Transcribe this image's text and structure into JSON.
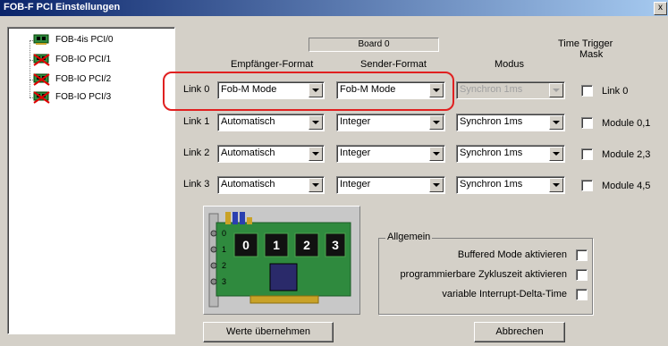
{
  "window": {
    "title": "FOB-F PCI Einstellungen",
    "close_label": "x"
  },
  "tree": [
    {
      "label": "FOB-4is PCI/0",
      "status": "ok"
    },
    {
      "label": "FOB-IO PCI/1",
      "status": "error"
    },
    {
      "label": "FOB-IO PCI/2",
      "status": "error"
    },
    {
      "label": "FOB-IO PCI/3",
      "status": "error"
    }
  ],
  "board_label": "Board 0",
  "headers": {
    "empfaenger": "Empfänger-Format",
    "sender": "Sender-Format",
    "modus": "Modus",
    "time_trigger": "Time Trigger",
    "mask": "Mask"
  },
  "links": [
    {
      "label": "Link 0",
      "empfaenger": "Fob-M Mode",
      "sender": "Fob-M Mode",
      "modus": "Synchron 1ms",
      "modus_disabled": true,
      "mask_label": "Link 0"
    },
    {
      "label": "Link 1",
      "empfaenger": "Automatisch",
      "sender": "Integer",
      "modus": "Synchron 1ms",
      "modus_disabled": false,
      "mask_label": "Module 0,1"
    },
    {
      "label": "Link 2",
      "empfaenger": "Automatisch",
      "sender": "Integer",
      "modus": "Synchron 1ms",
      "modus_disabled": false,
      "mask_label": "Module 2,3"
    },
    {
      "label": "Link 3",
      "empfaenger": "Automatisch",
      "sender": "Integer",
      "modus": "Synchron 1ms",
      "modus_disabled": false,
      "mask_label": "Module 4,5"
    }
  ],
  "card": {
    "chips": [
      "0",
      "1",
      "2",
      "3"
    ],
    "ports": [
      "0",
      "1",
      "2",
      "3"
    ]
  },
  "allgemein": {
    "legend": "Allgemein",
    "options": [
      "Buffered Mode aktivieren",
      "programmierbare Zykluszeit aktivieren",
      "variable Interrupt-Delta-Time"
    ]
  },
  "buttons": {
    "apply": "Werte übernehmen",
    "cancel": "Abbrechen"
  },
  "colors": {
    "highlight_oval": "#e02020",
    "pcb_green": "#2f8a3e"
  }
}
